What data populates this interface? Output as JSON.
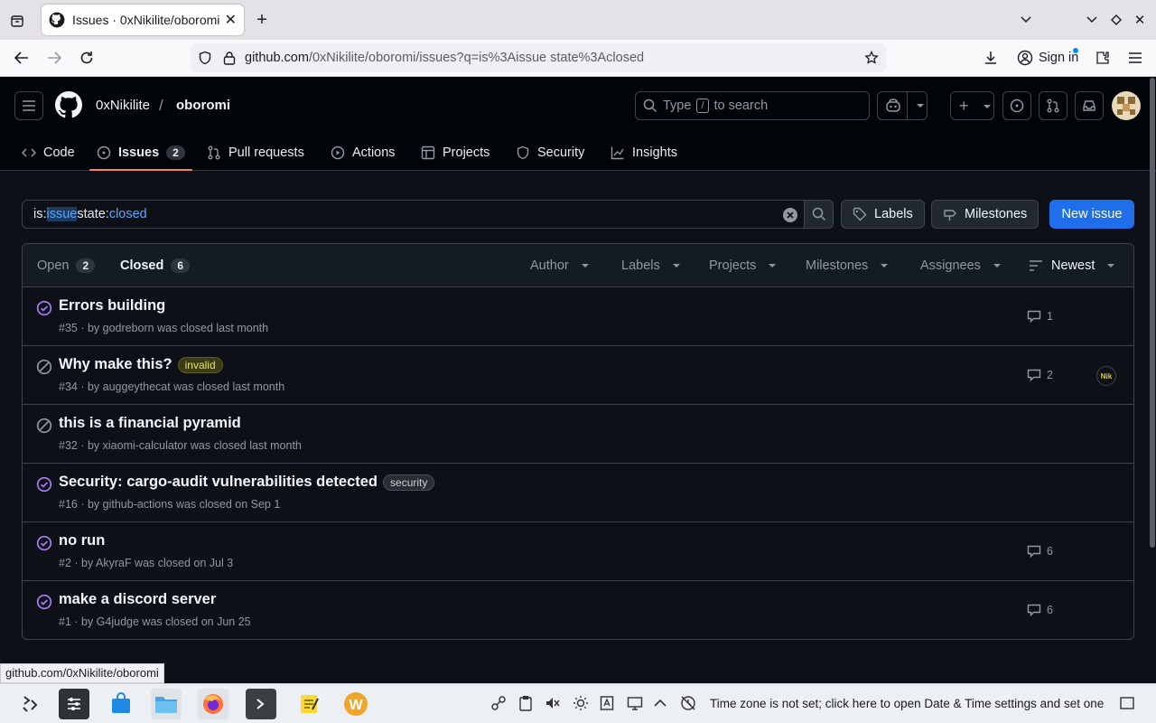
{
  "browser": {
    "tab_title": "Issues · 0xNikilite/oboromi",
    "url_host": "github.com",
    "url_path": "/0xNikilite/oboromi/issues?q=is%3Aissue state%3Aclosed",
    "sign_in": "Sign in",
    "status_url": "github.com/0xNikilite/oboromi"
  },
  "header": {
    "owner": "0xNikilite",
    "separator": "/",
    "repo": "oboromi",
    "search_pre": "Type",
    "search_key": "/",
    "search_post": "to search"
  },
  "repo_tabs": [
    {
      "label": "Code",
      "icon": "code-icon"
    },
    {
      "label": "Issues",
      "count": "2",
      "icon": "issue-opened-icon"
    },
    {
      "label": "Pull requests",
      "icon": "git-pull-request-icon"
    },
    {
      "label": "Actions",
      "icon": "play-icon"
    },
    {
      "label": "Projects",
      "icon": "table-icon"
    },
    {
      "label": "Security",
      "icon": "shield-icon"
    },
    {
      "label": "Insights",
      "icon": "graph-icon"
    }
  ],
  "toolbar": {
    "q_is": "is:",
    "q_issue": "issue",
    "q_state": " state:",
    "q_closed": "closed",
    "labels": "Labels",
    "milestones": "Milestones",
    "new_issue": "New issue"
  },
  "list_header": {
    "open_label": "Open",
    "open_count": "2",
    "closed_label": "Closed",
    "closed_count": "6",
    "filters": [
      "Author",
      "Labels",
      "Projects",
      "Milestones",
      "Assignees"
    ],
    "sort": "Newest"
  },
  "issues": [
    {
      "title": "Errors building",
      "meta": "#35 · by godreborn was closed last month",
      "comments": "1",
      "state": "completed",
      "label": ""
    },
    {
      "title": "Why make this?",
      "meta": "#34 · by auggeythecat was closed last month",
      "comments": "2",
      "state": "not-planned",
      "label": "invalid",
      "assignee": "Nik"
    },
    {
      "title": "this is a financial pyramid",
      "meta": "#32 · by xiaomi-calculator was closed last month",
      "comments": "",
      "state": "not-planned",
      "label": ""
    },
    {
      "title": "Security: cargo-audit vulnerabilities detected",
      "meta": "#16 · by github-actions was closed on Sep 1",
      "comments": "",
      "state": "completed",
      "label": "security"
    },
    {
      "title": "no run",
      "meta": "#2 · by AkyraF was closed on Jul 3",
      "comments": "6",
      "state": "completed",
      "label": ""
    },
    {
      "title": "make a discord server",
      "meta": "#1 · by G4judge was closed on Jun 25",
      "comments": "6",
      "state": "completed",
      "label": ""
    }
  ],
  "taskbar": {
    "clock_message": "Time zone is not set; click here to open Date & Time settings and set one"
  },
  "colors": {
    "accent": "#1f6feb",
    "closed_icon": "#ab7df8",
    "not_planned_icon": "#9198a1",
    "tab_underline": "#f78166",
    "invalid_label": "#e4e669",
    "security_label": "#cccccc"
  }
}
